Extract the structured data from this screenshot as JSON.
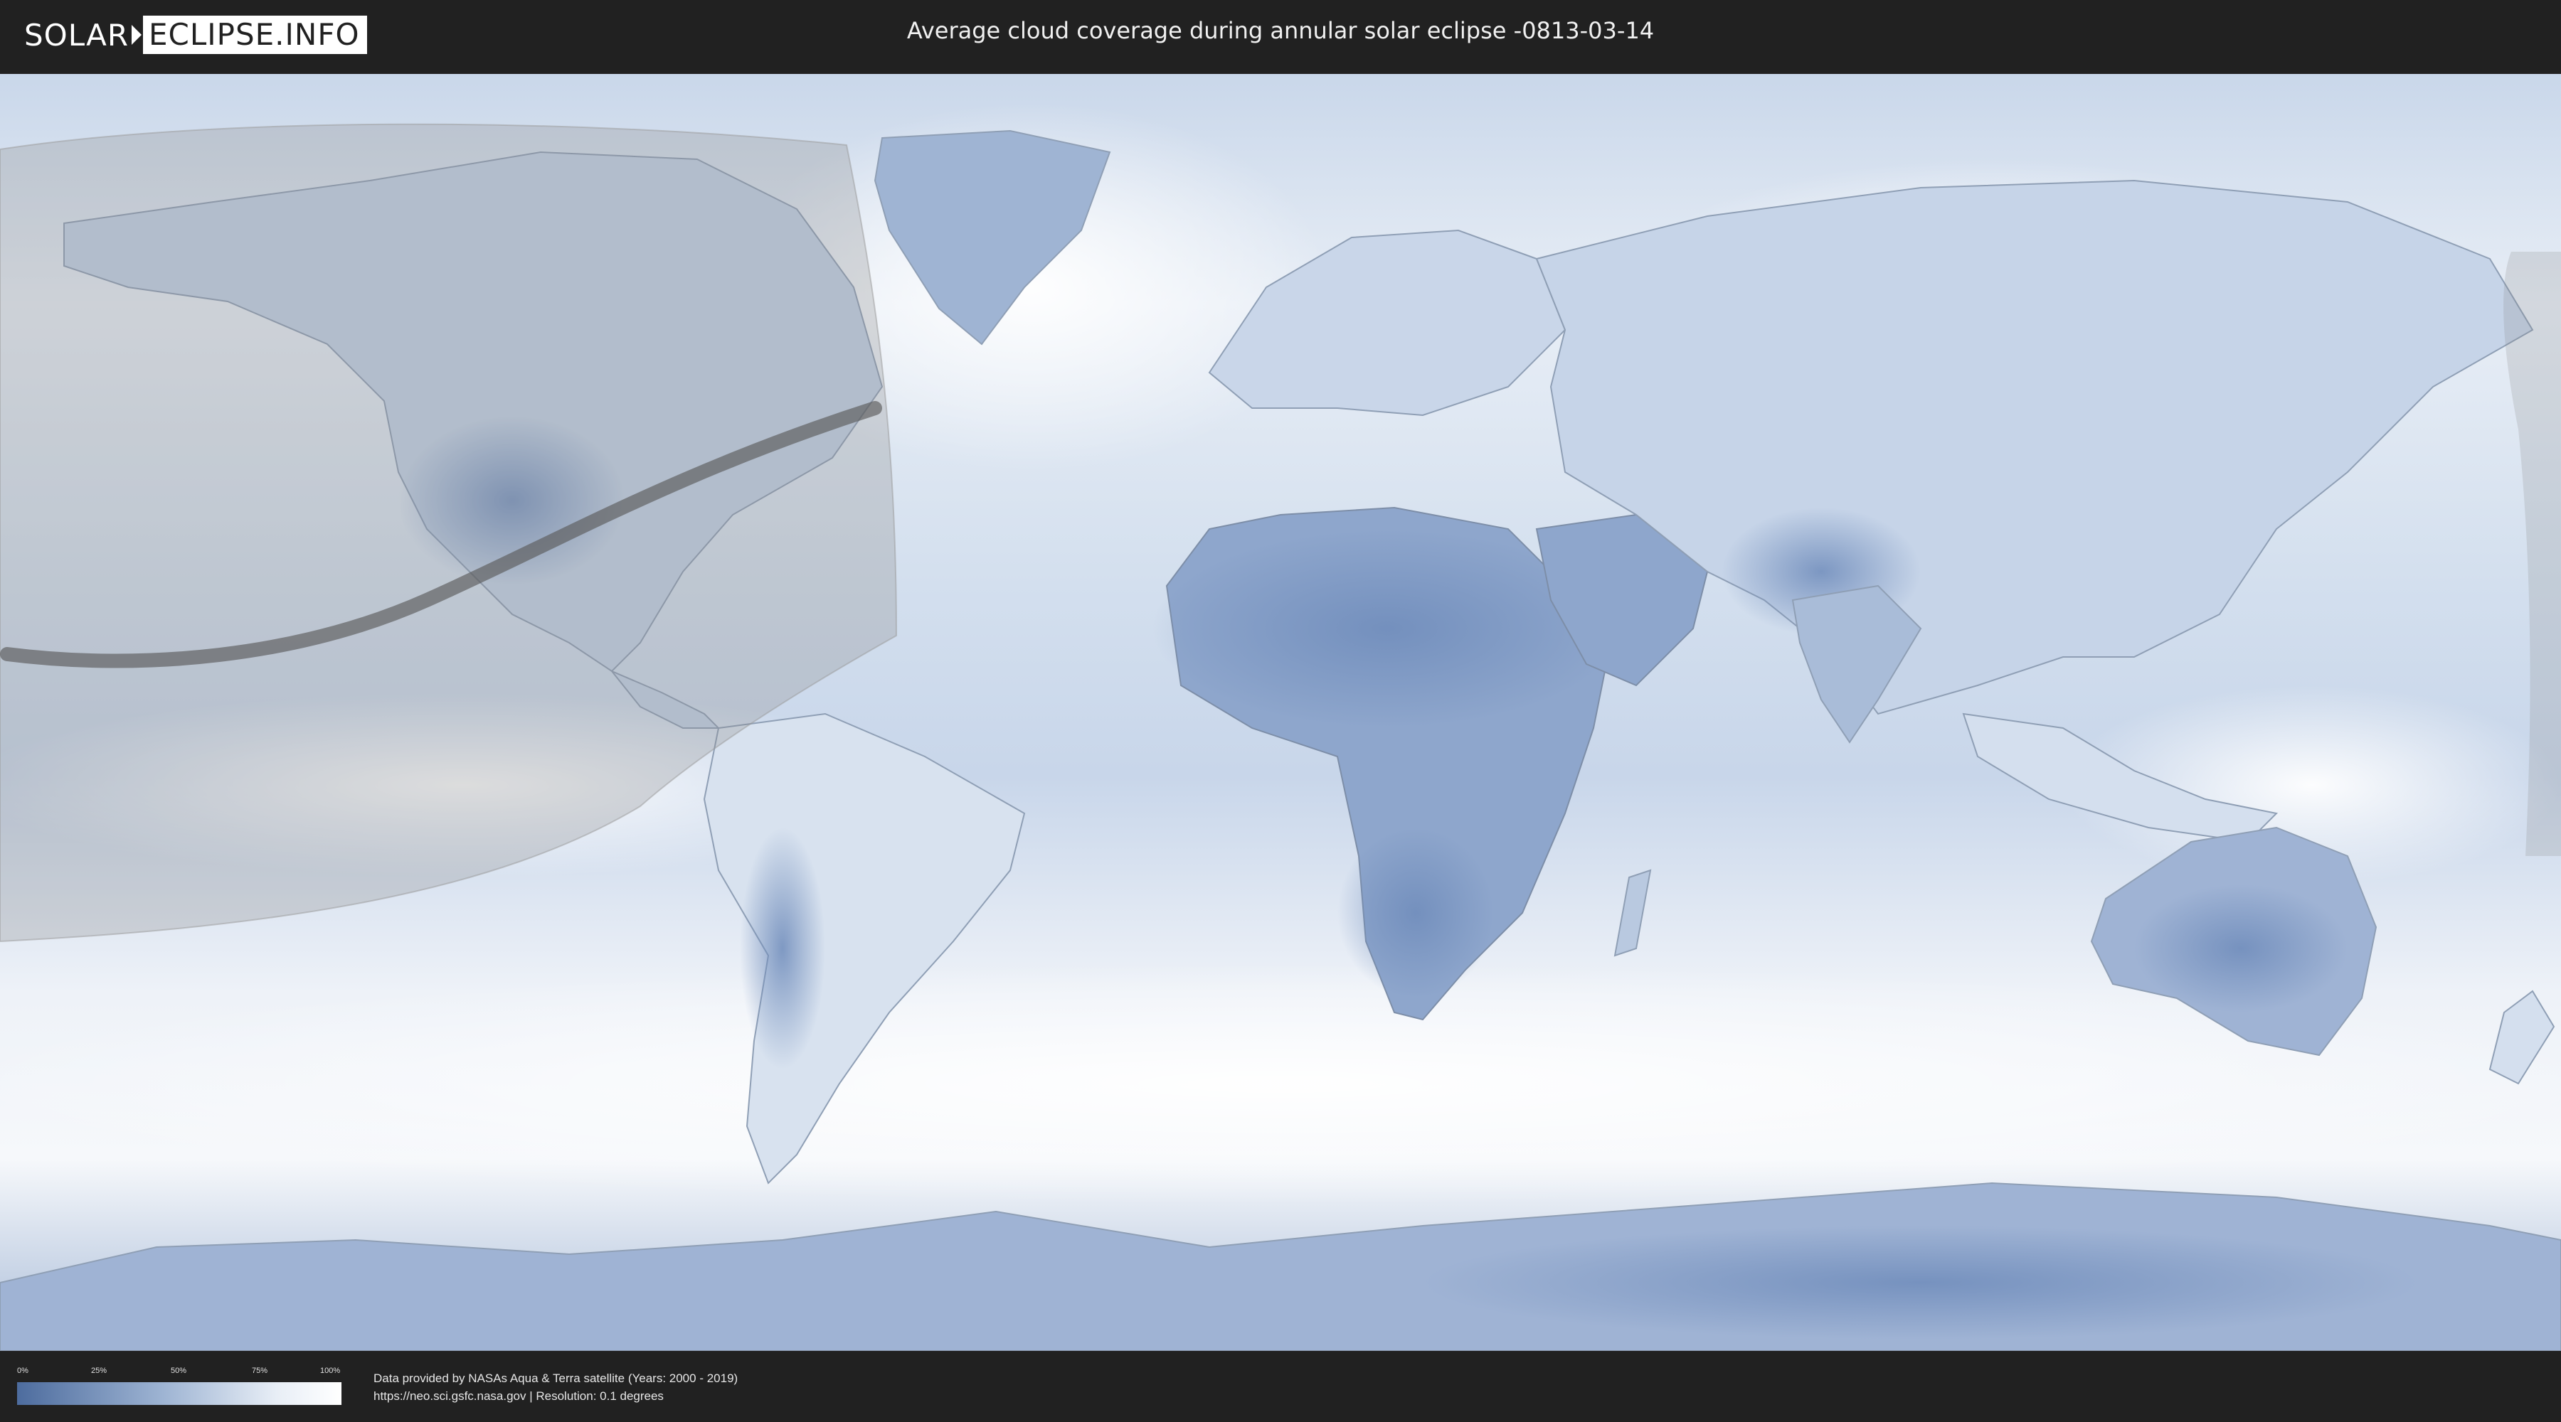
{
  "header": {
    "logo_left": "SOLAR",
    "logo_right": "ECLIPSE.INFO",
    "title": "Average cloud coverage during annular solar eclipse -0813-03-14"
  },
  "legend": {
    "ticks": [
      "0%",
      "25%",
      "50%",
      "75%",
      "100%"
    ],
    "gradient_colors": [
      "#4d6c9e",
      "#9eb4d3",
      "#e8eef6",
      "#ffffff"
    ]
  },
  "footer": {
    "credit_line": "Data provided by NASAs Aqua & Terra satellite (Years: 2000 - 2019)",
    "source_line": "https://neo.sci.gsfc.nasa.gov | Resolution: 0.1 degrees"
  },
  "map": {
    "projection": "equirectangular",
    "layers": [
      "cloud-coverage",
      "country-borders",
      "eclipse-visibility-zone",
      "annularity-path"
    ],
    "colors": {
      "clear": "#6a88b8",
      "cloudy": "#ffffff",
      "ocean_base": "#dfe8f3",
      "visibility_zone": "#8a8a8a",
      "path": "#555555"
    }
  }
}
